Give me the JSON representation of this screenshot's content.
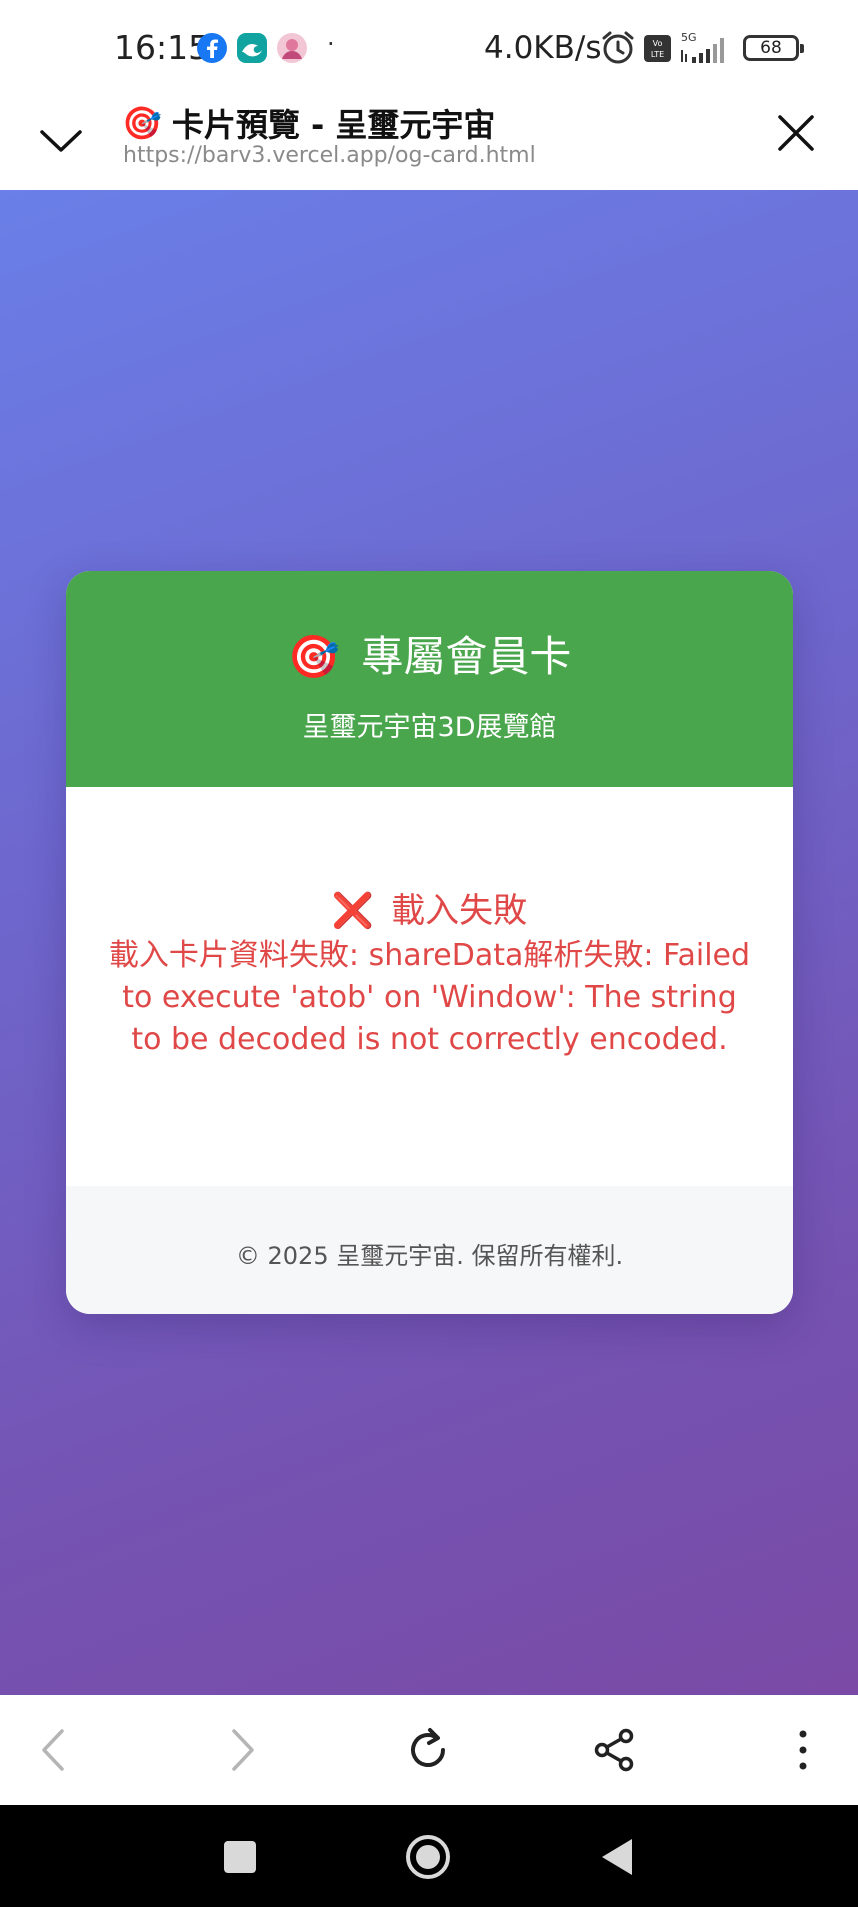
{
  "status_bar": {
    "time": "16:15",
    "network_speed": "4.0KB/s",
    "dot": "·",
    "network_type": "5G",
    "battery": "68",
    "icons": [
      "facebook-icon",
      "wave-app-icon",
      "avatar-app-icon",
      "alarm-icon",
      "volte-icon",
      "signal-icon",
      "battery-icon"
    ]
  },
  "browser_header": {
    "title_emoji": "🎯",
    "title": "卡片預覽 - 呈璽元宇宙",
    "url": "https://barv3.vercel.app/og-card.html"
  },
  "card": {
    "header_emoji": "🎯",
    "title": "專屬會員卡",
    "subtitle": "呈璽元宇宙3D展覽館",
    "error_icon": "❌",
    "error_title": "載入失敗",
    "error_message": "載入卡片資料失敗: shareData解析失敗: Failed to execute 'atob' on 'Window': The string to be decoded is not correctly encoded.",
    "footer": "© 2025 呈璽元宇宙. 保留所有權利."
  },
  "colors": {
    "header_green": "#4aa64c",
    "error_red": "#e04848",
    "gradient_start": "#6a7fe8",
    "gradient_end": "#7a4aa6"
  },
  "toolbar": {
    "icons": [
      "back-icon",
      "forward-icon",
      "reload-icon",
      "share-icon",
      "more-icon"
    ]
  },
  "nav_bar": {
    "icons": [
      "recents-icon",
      "home-icon",
      "back-triangle-icon"
    ]
  }
}
